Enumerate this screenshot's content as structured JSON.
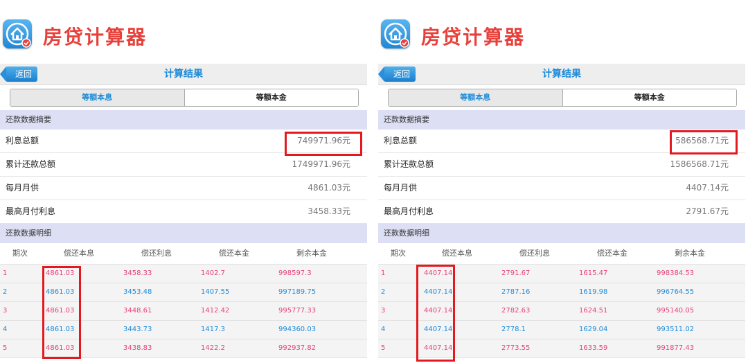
{
  "panels": [
    {
      "app_title": "房贷计算器",
      "back_label": "返回",
      "nav_title": "计算结果",
      "tabs": [
        "等额本息",
        "等额本金"
      ],
      "summary_header": "还款数据摘要",
      "summary": [
        {
          "label": "利息总额",
          "value": "749971.96元"
        },
        {
          "label": "累计还款总额",
          "value": "1749971.96元"
        },
        {
          "label": "每月月供",
          "value": "4861.03元"
        },
        {
          "label": "最高月付利息",
          "value": "3458.33元"
        }
      ],
      "detail_header": "还款数据明细",
      "columns": [
        "期次",
        "偿还本息",
        "偿还利息",
        "偿还本金",
        "剩余本金"
      ],
      "rows": [
        [
          "1",
          "4861.03",
          "3458.33",
          "1402.7",
          "998597.3"
        ],
        [
          "2",
          "4861.03",
          "3453.48",
          "1407.55",
          "997189.75"
        ],
        [
          "3",
          "4861.03",
          "3448.61",
          "1412.42",
          "995777.33"
        ],
        [
          "4",
          "4861.03",
          "3443.73",
          "1417.3",
          "994360.03"
        ],
        [
          "5",
          "4861.03",
          "3438.83",
          "1422.2",
          "992937.82"
        ]
      ]
    },
    {
      "app_title": "房贷计算器",
      "back_label": "返回",
      "nav_title": "计算结果",
      "tabs": [
        "等额本息",
        "等额本金"
      ],
      "summary_header": "还款数据摘要",
      "summary": [
        {
          "label": "利息总额",
          "value": "586568.71元"
        },
        {
          "label": "累计还款总额",
          "value": "1586568.71元"
        },
        {
          "label": "每月月供",
          "value": "4407.14元"
        },
        {
          "label": "最高月付利息",
          "value": "2791.67元"
        }
      ],
      "detail_header": "还款数据明细",
      "columns": [
        "期次",
        "偿还本息",
        "偿还利息",
        "偿还本金",
        "剩余本金"
      ],
      "rows": [
        [
          "1",
          "4407.14",
          "2791.67",
          "1615.47",
          "998384.53"
        ],
        [
          "2",
          "4407.14",
          "2787.16",
          "1619.98",
          "996764.55"
        ],
        [
          "3",
          "4407.14",
          "2782.63",
          "1624.51",
          "995140.05"
        ],
        [
          "4",
          "4407.14",
          "2778.1",
          "1629.04",
          "993511.02"
        ],
        [
          "5",
          "4407.14",
          "2773.55",
          "1633.59",
          "991877.43"
        ]
      ]
    }
  ],
  "colors": {
    "title_red": "#e8403a",
    "accent_blue": "#1b8bd8",
    "odd_row_pink": "#e8437a",
    "highlight_red": "#e3191f",
    "section_bg": "#dde0f5"
  },
  "icons": {
    "app": "house-icon",
    "badge": "check-badge-icon"
  }
}
